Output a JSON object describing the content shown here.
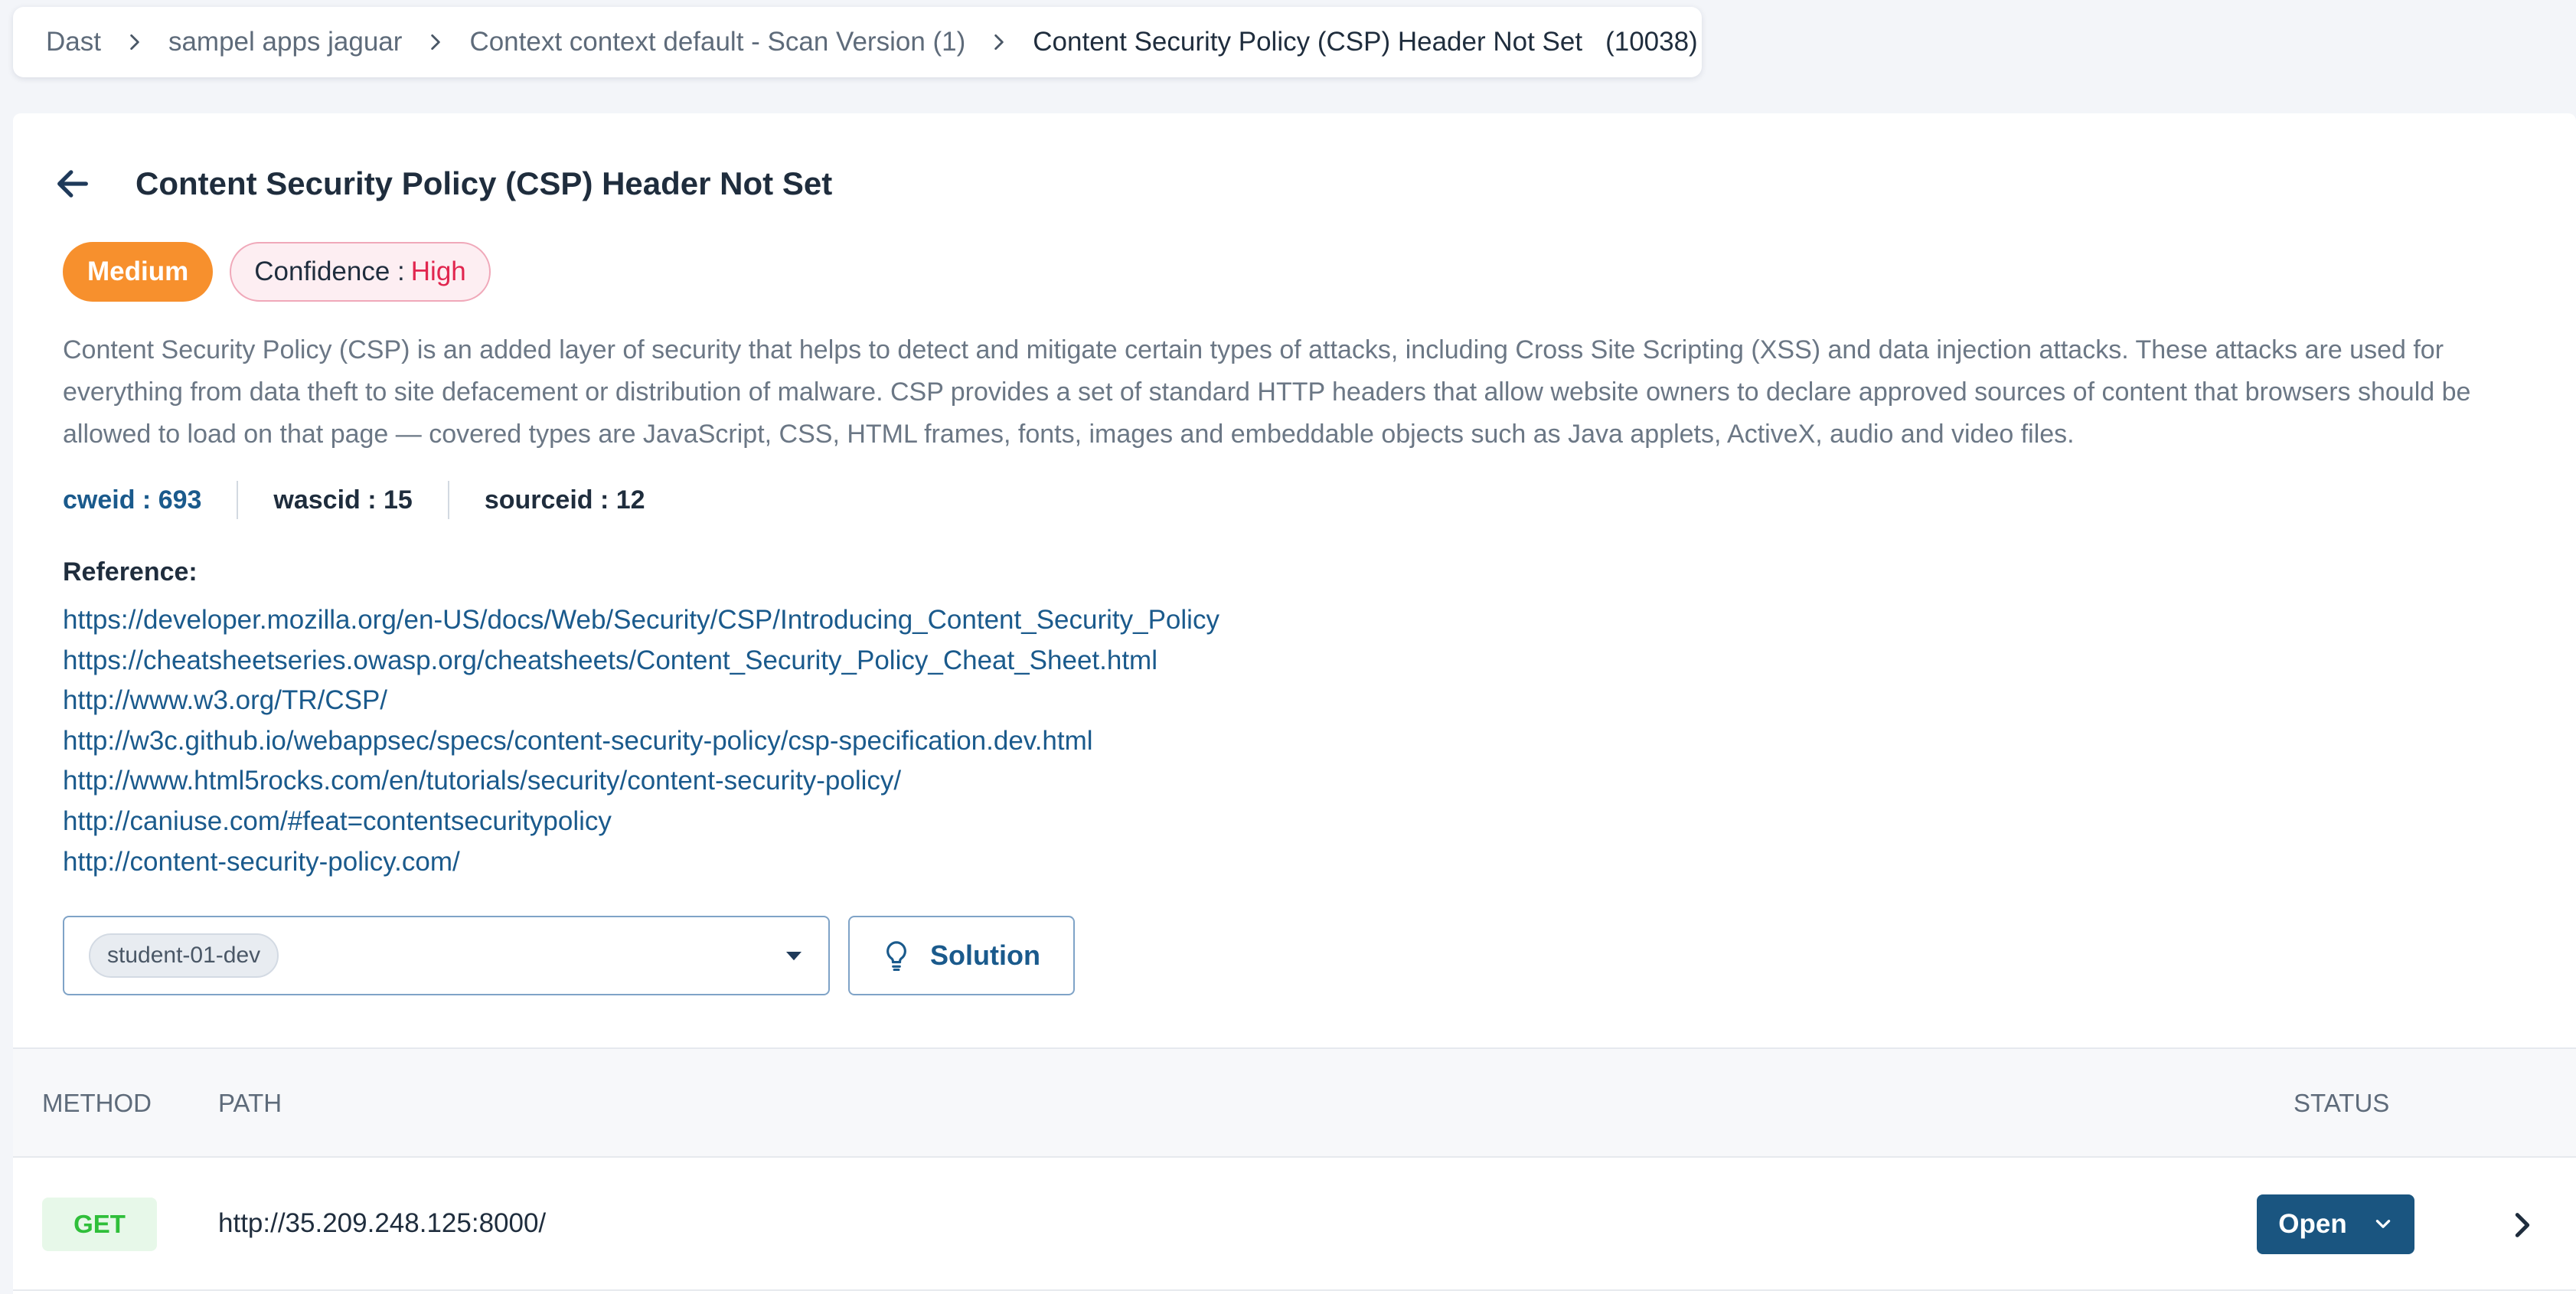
{
  "breadcrumb": {
    "items": [
      "Dast",
      "sampel apps jaguar",
      "Context context default - Scan Version (1)",
      "Content Security Policy (CSP) Header Not Set"
    ],
    "count": "(10038)"
  },
  "alert": {
    "title": "Content Security Policy (CSP) Header Not Set",
    "severity": "Medium",
    "confidence_label": "Confidence :",
    "confidence_value": "High",
    "description": "Content Security Policy (CSP) is an added layer of security that helps to detect and mitigate certain types of attacks, including Cross Site Scripting (XSS) and data injection attacks. These attacks are used for everything from data theft to site defacement or distribution of malware. CSP provides a set of standard HTTP headers that allow website owners to declare approved sources of content that browsers should be allowed to load on that page — covered types are JavaScript, CSS, HTML frames, fonts, images and embeddable objects such as Java applets, ActiveX, audio and video files.",
    "ids": {
      "cweid": "cweid : 693",
      "wascid": "wascid : 15",
      "sourceid": "sourceid : 12"
    },
    "reference_label": "Reference:",
    "references": [
      "https://developer.mozilla.org/en-US/docs/Web/Security/CSP/Introducing_Content_Security_Policy",
      "https://cheatsheetseries.owasp.org/cheatsheets/Content_Security_Policy_Cheat_Sheet.html",
      "http://www.w3.org/TR/CSP/",
      "http://w3c.github.io/webappsec/specs/content-security-policy/csp-specification.dev.html",
      "http://www.html5rocks.com/en/tutorials/security/content-security-policy/",
      "http://caniuse.com/#feat=contentsecuritypolicy",
      "http://content-security-policy.com/"
    ]
  },
  "controls": {
    "assignee_chip": "student-01-dev",
    "solution_label": "Solution"
  },
  "table": {
    "headers": {
      "method": "Method",
      "path": "Path",
      "status": "Status"
    },
    "rows": [
      {
        "method": "GET",
        "path": "http://35.209.248.125:8000/",
        "status": "Open"
      }
    ]
  },
  "colors": {
    "severity_medium": "#f7902d",
    "confidence_high": "#e1264f",
    "link": "#1a5a8c",
    "status_button": "#1a5580",
    "method_get": "#2fbf3a"
  },
  "icons": [
    "chevron-right-icon",
    "arrow-left-icon",
    "caret-down-icon",
    "lightbulb-icon",
    "chevron-down-icon"
  ]
}
